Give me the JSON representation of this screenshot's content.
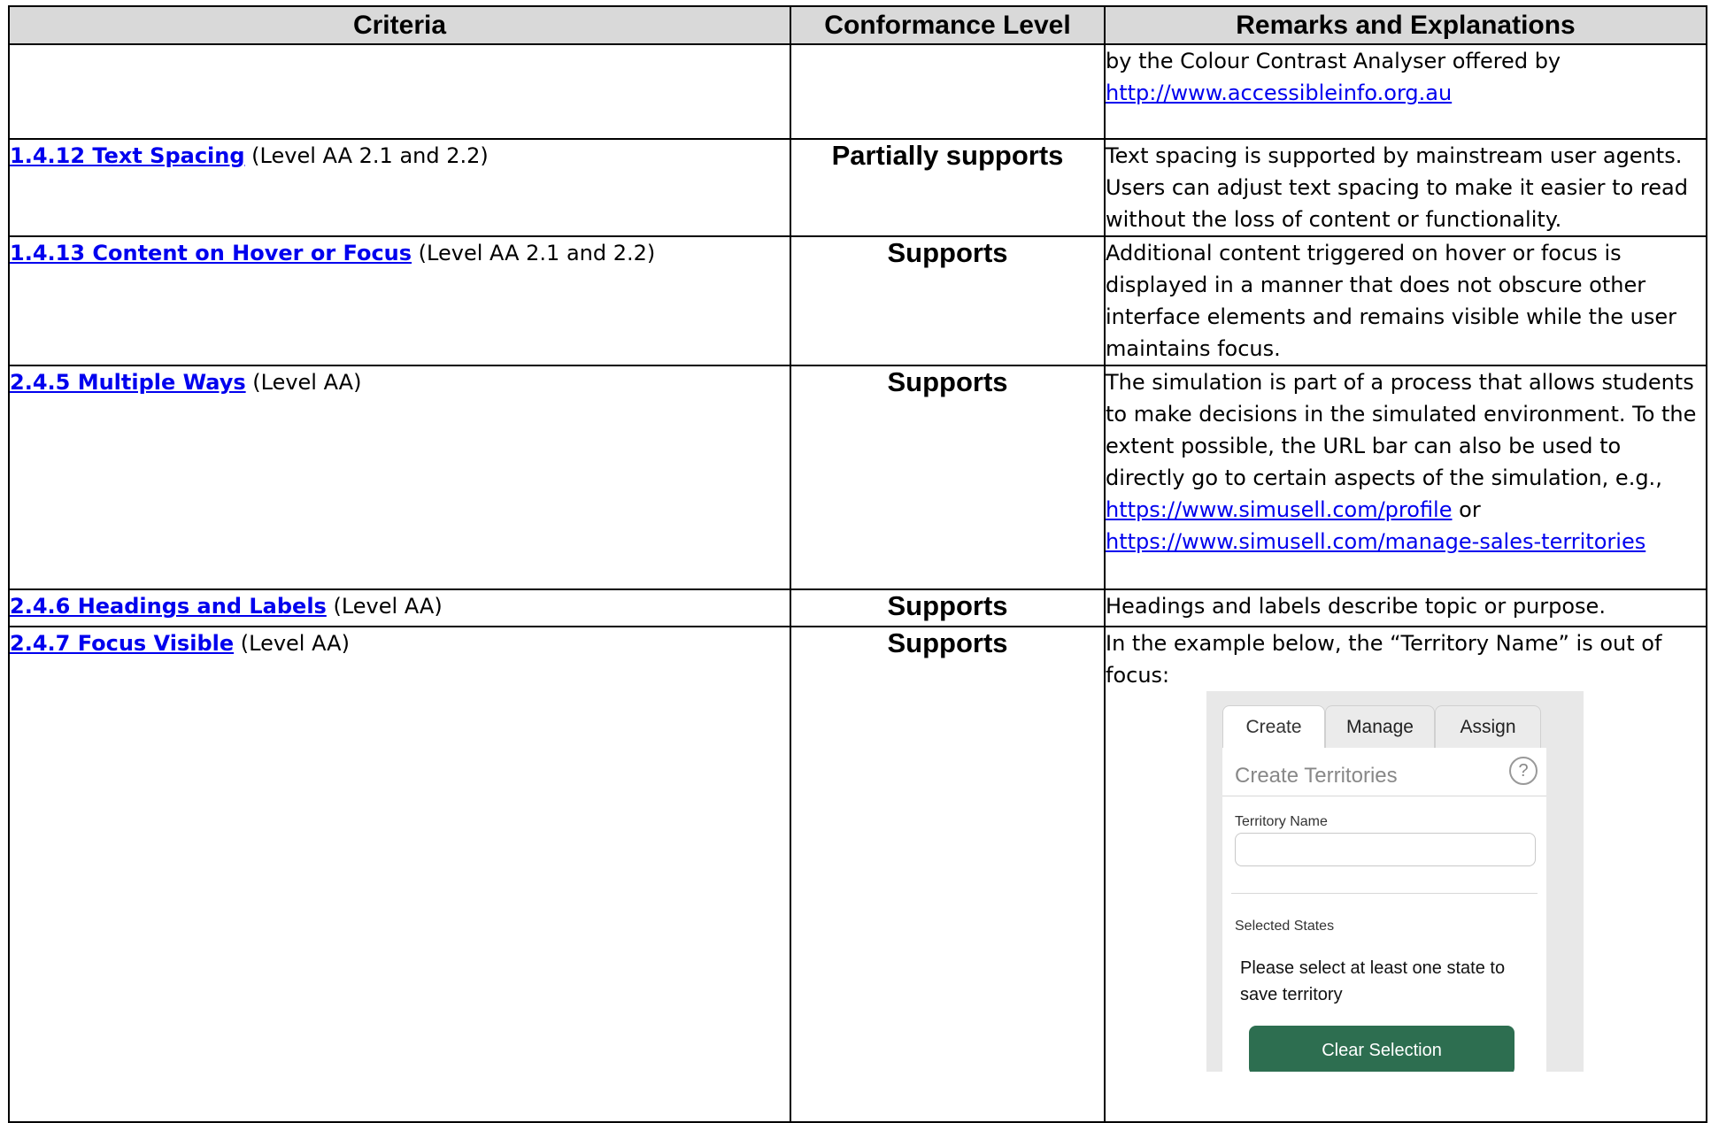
{
  "headers": {
    "criteria": "Criteria",
    "level": "Conformance Level",
    "remarks": "Remarks and Explanations"
  },
  "rows": [
    {
      "criteria_link": "",
      "criteria_suffix": "",
      "level": "",
      "remarks_lines": [
        "by the Colour Contrast Analyser offered by"
      ],
      "remarks_links": [
        "http://www.accessibleinfo.org.au"
      ]
    },
    {
      "criteria_link": "1.4.12 Text Spacing",
      "criteria_suffix": " (Level AA 2.1 and 2.2)",
      "level": "Partially supports",
      "remarks": "Text spacing is supported by mainstream user agents. Users can adjust text spacing to make it easier to read without the loss of content or functionality."
    },
    {
      "criteria_link": "1.4.13 Content on Hover or Focus",
      "criteria_suffix": " (Level AA 2.1 and 2.2)",
      "level": "Supports",
      "remarks": "Additional content triggered on hover or focus is displayed in a manner that does not obscure other interface elements and remains visible while the user maintains focus."
    },
    {
      "criteria_link": "2.4.5 Multiple Ways",
      "criteria_suffix": " (Level AA)",
      "level": "Supports",
      "remarks": "The simulation is part of a process that allows students to make decisions in the simulated environment. To the extent possible, the URL bar can also be used to directly go to certain aspects of the simulation, e.g.,",
      "link1": "https://www.simusell.com/profile",
      "link_join": " or",
      "link2": "https://www.simusell.com/manage-sales-territories"
    },
    {
      "criteria_link": "2.4.6 Headings and Labels",
      "criteria_suffix": " (Level AA)",
      "level": "Supports",
      "remarks": "Headings and labels describe topic or purpose."
    },
    {
      "criteria_link": "2.4.7 Focus Visible",
      "criteria_suffix": " (Level AA)",
      "level": "Supports",
      "remarks": "In the example below, the “Territory Name” is out of focus:"
    }
  ],
  "screenshot": {
    "tabs": [
      "Create",
      "Manage",
      "Assign"
    ],
    "active_tab": "Create",
    "title": "Create Territories",
    "help_icon": "?",
    "field_label": "Territory Name",
    "states_label": "Selected States",
    "message": "Please select at least one state to save territory",
    "button": "Clear Selection",
    "button_color": "#2d6e50"
  },
  "colors": {
    "header_bg": "#d9d9d9",
    "link": "#0000ee"
  }
}
